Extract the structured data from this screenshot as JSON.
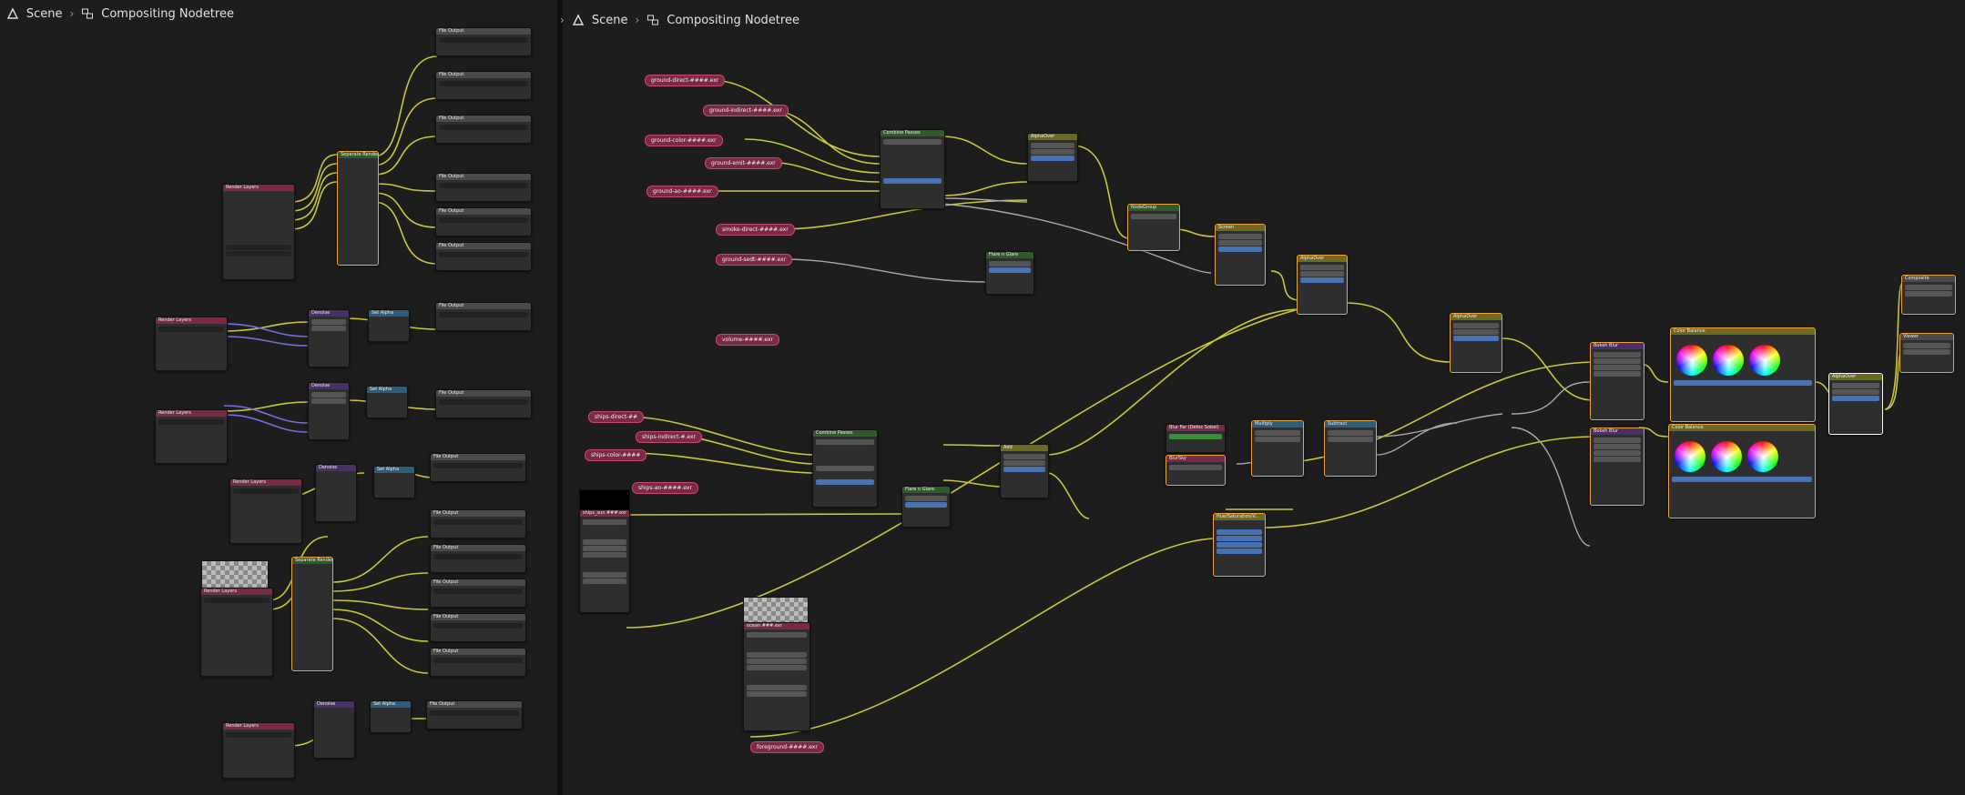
{
  "breadcrumbs": {
    "left": {
      "scene": "Scene",
      "tree": "Compositing Nodetree"
    },
    "right": {
      "scene": "Scene",
      "tree": "Compositing Nodetree"
    }
  },
  "icons": {
    "scene": "scene-icon",
    "nodetree": "node-tree-icon",
    "separator": "chevron-right-icon"
  },
  "colors": {
    "background": "#1d1d1d",
    "render_header": "#7a2a44",
    "color_header": "#6b6a1e",
    "converter_header": "#2c5d7a",
    "filter_header": "#4a2f6b",
    "selected_outline": "#f0a33a",
    "wire_yellow": "#c8c83a",
    "wire_grey": "#a8a8a8",
    "wire_blue": "#6a6ad0"
  },
  "right_nodes": {
    "combine_passes_1": "Combine Passes",
    "combine_passes_2": "Combine Passes",
    "alpha_over_1": "AlphaOver",
    "alpha_over_2": "AlphaOver",
    "alpha_over_3": "AlphaOver",
    "alpha_over_4": "AlphaOver",
    "node_group": "NodeGroup",
    "screen": "Screen",
    "flare_1": "Flare n Glare",
    "flare_2": "Flare n Glare",
    "add": "Add",
    "blur_far": "Blur Far (Defoc Sobel)",
    "blur_sky": "BlurSky",
    "multiply": "Multiply",
    "subtract": "Subtract",
    "hue_sat": "Hue/Saturation/V...",
    "bokeh_blur_1": "Bokeh Blur",
    "bokeh_blur_2": "Bokeh Blur",
    "color_balance_1": "Color Balance",
    "color_balance_2": "Color Balance",
    "composite": "Composite",
    "viewer": "Viewer",
    "image_1": "ships_sun.###.exr",
    "image_2": "ocean.###.exr"
  },
  "reroutes": [
    "ground-direct-####.exr",
    "ground-indirect-####.exr",
    "ground-color-####.exr",
    "ground-emit-####.exr",
    "ground-ao-####.exr",
    "smoke-direct-####.exr",
    "ground-sedt-####.exr",
    "volume-####.exr",
    "ships-direct-##",
    "ships-indirect-#.exr",
    "ships-color-####",
    "ships-ao-####.exr",
    "foreground-####.exr"
  ],
  "left_nodes": {
    "render_layers": "Render Layers",
    "file_output": "File Output",
    "denoise": "Denoise",
    "set_alpha": "Set Alpha",
    "separate": "Separate Render"
  }
}
